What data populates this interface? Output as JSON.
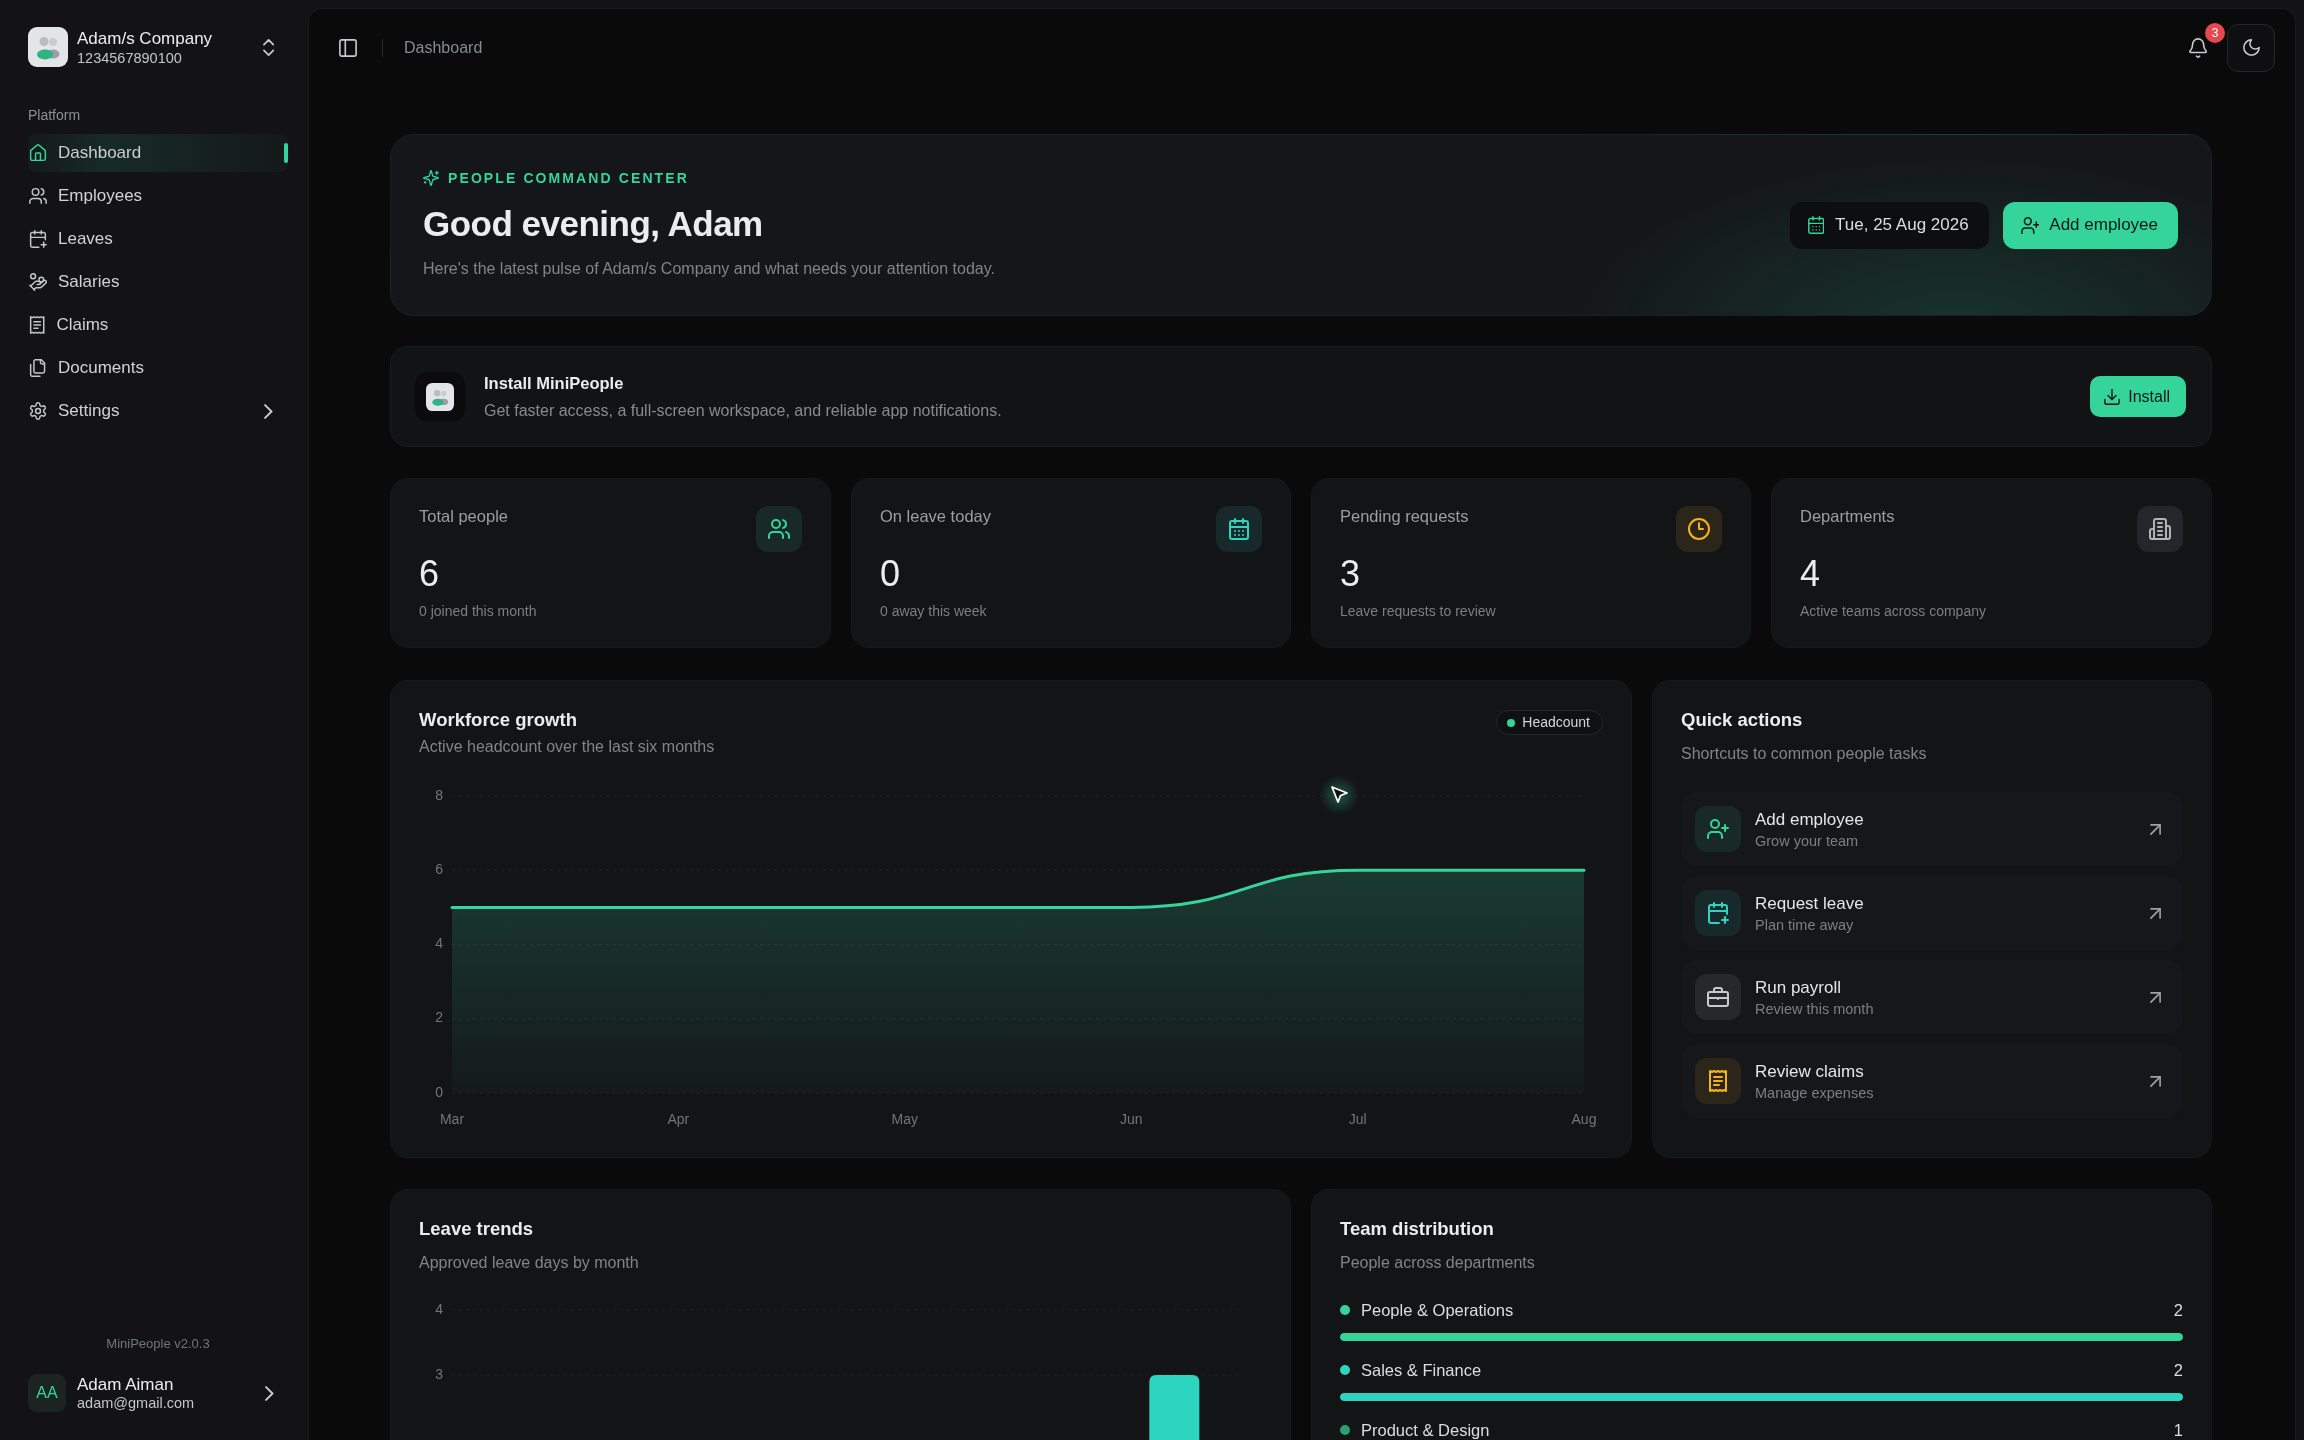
{
  "sidebar": {
    "company": {
      "name": "Adam/s Company",
      "id": "1234567890100"
    },
    "section_label": "Platform",
    "items": [
      {
        "label": "Dashboard",
        "selected": true,
        "expandable": false
      },
      {
        "label": "Employees",
        "selected": false,
        "expandable": false
      },
      {
        "label": "Leaves",
        "selected": false,
        "expandable": false
      },
      {
        "label": "Salaries",
        "selected": false,
        "expandable": false
      },
      {
        "label": "Claims",
        "selected": false,
        "expandable": false
      },
      {
        "label": "Documents",
        "selected": false,
        "expandable": false
      },
      {
        "label": "Settings",
        "selected": false,
        "expandable": true
      }
    ],
    "version": "MiniPeople v2.0.3",
    "user": {
      "initials": "AA",
      "name": "Adam Aiman",
      "email": "adam@gmail.com"
    }
  },
  "header": {
    "breadcrumb": "Dashboard",
    "notification_count": "3"
  },
  "hero": {
    "eyebrow": "PEOPLE COMMAND CENTER",
    "title": "Good evening, Adam",
    "subtitle": "Here's the latest pulse of Adam/s Company and what needs your attention today.",
    "date": "Tue, 25 Aug 2026",
    "button": "Add employee"
  },
  "install_banner": {
    "title": "Install MiniPeople",
    "description": "Get faster access, a full-screen workspace, and reliable app notifications.",
    "button": "Install"
  },
  "stats": [
    {
      "label": "Total people",
      "value": "6",
      "note": "0 joined this month"
    },
    {
      "label": "On leave today",
      "value": "0",
      "note": "0 away this week"
    },
    {
      "label": "Pending requests",
      "value": "3",
      "note": "Leave requests to review"
    },
    {
      "label": "Departments",
      "value": "4",
      "note": "Active teams across company"
    }
  ],
  "workforce_growth": {
    "title": "Workforce growth",
    "subtitle": "Active headcount over the last six months",
    "chart_data": {
      "type": "area",
      "categories": [
        "Mar",
        "Apr",
        "May",
        "Jun",
        "Jul",
        "Aug"
      ],
      "series": [
        {
          "name": "Headcount",
          "color": "#35d49a",
          "values": [
            5,
            5,
            5,
            5,
            6,
            6
          ]
        }
      ],
      "ylim": [
        0,
        8
      ],
      "yticks": [
        0,
        2,
        4,
        6,
        8
      ],
      "grid": true
    }
  },
  "quick_actions": {
    "title": "Quick actions",
    "subtitle": "Shortcuts to common people tasks",
    "items": [
      {
        "title": "Add employee",
        "subtitle": "Grow your team"
      },
      {
        "title": "Request leave",
        "subtitle": "Plan time away"
      },
      {
        "title": "Run payroll",
        "subtitle": "Review this month"
      },
      {
        "title": "Review claims",
        "subtitle": "Manage expenses"
      }
    ]
  },
  "leave_trends": {
    "title": "Leave trends",
    "subtitle": "Approved leave days by month",
    "y_axis_labels": [
      "4",
      "3"
    ]
  },
  "team_distribution": {
    "title": "Team distribution",
    "subtitle": "People across departments",
    "items": [
      {
        "name": "People & Operations",
        "count": "2",
        "color": "#35d49a",
        "level": 1
      },
      {
        "name": "Sales & Finance",
        "count": "2",
        "color": "#2dd4bf",
        "level": 1
      },
      {
        "name": "Product & Design",
        "count": "1",
        "color": "#27a26f"
      }
    ]
  }
}
